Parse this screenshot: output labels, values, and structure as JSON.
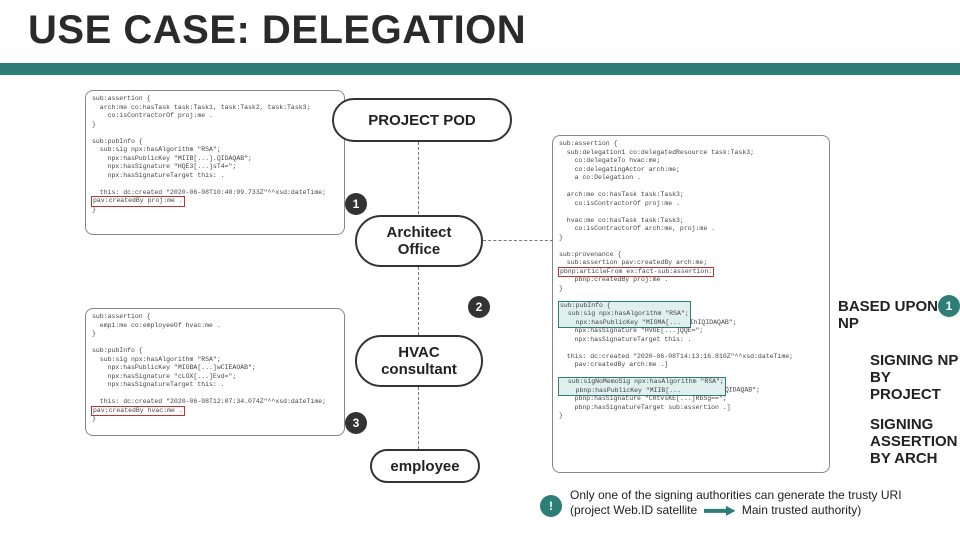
{
  "title": "USE CASE:   DELEGATION",
  "pills": {
    "project_pod": "PROJECT POD",
    "architect_office": "Architect\nOffice",
    "hvac_consultant": "HVAC\nconsultant",
    "employee": "employee"
  },
  "badges": {
    "n1": "1",
    "n2": "2",
    "n3": "3",
    "np1": "1",
    "excl": "!"
  },
  "labels": {
    "based_upon_np": "BASED UPON NP",
    "signing_project": "SIGNING NP\nBY PROJECT",
    "signing_arch": "SIGNING\nASSERTION\nBY ARCH"
  },
  "footer": {
    "line1": "Only one of the signing authorities can generate the trusty URI",
    "line2a": "(project Web.ID satellite",
    "line2b": "Main trusted authority)"
  },
  "code": {
    "box_tl": "sub:assertion {\n  arch:me co:hasTask task:Task1, task:Task2, task:Task3;\n    co:isContractorOf proj:me .\n}\n\nsub:pubInfo {\n  sub:sig npx:hasAlgorithm \"RSA\";\n    npx:hasPublicKey \"MIIB[...].QIDAQAB\";\n    npx:hasSignature \"HQE3[...]sT4=\";\n    npx:hasSignatureTarget this: .\n\n  this: dc:created \"2020-06-08T10:40:09.733Z\"^^xsd:dateTime;\nHL_RED[pav:createdBy proj:me .]\n}",
    "box_bl": "sub:assertion {\n  emp1:me co:employeeOf hvac:me .\n}\n\nsub:pubInfo {\n  sub:sig npx:hasAlgorithm \"RSA\";\n    npx:hasPublicKey \"MIGBA[...]wCIEAOAB\";\n    npx:hasSignature \"cLOX[...]Evd=\";\n    npx:hasSignatureTarget this: .\n\n  this: dc:created \"2020-06-08T12:07:34.074Z\"^^xsd:dateTime;\nHL_RED[pav:createdBy hvac:me .]\n}",
    "box_tr": "sub:assertion {\n  sub:delegation1 co:delegatedResource task:Task3;\n    co:delegateTo hvac:me;\n    co:delegatingActor arch:me;\n    a co:Delegation .\n\n  arch:me co:hasTask task:Task3;\n    co:isContractorOf proj:me .\n\n  hvac:me co:hasTask task:Task3;\n    co:isContractorOf arch:me, proj:me .\n}\n\nsub:provenance {\n  sub:assertion pav:createdBy arch:me;\nHL_RED[pbnp:articleFrom ex:fact-sub:assertion:]\n    pbnp:createdBy proj:me .\n}\n\nHL_TEAL[sub:pubInfo {\n  sub:sig npx:hasAlgorithm \"RSA\";\n    npx:hasPublicKey \"MIGMA[...]IhIQIDAQAB\";\n    npx:hasSignature \"HVGE[...]QQE=\";\n    npx:hasSignatureTarget this: .\n\n  this: dc:created \"2020-06-08T14:13:16.810Z\"^^xsd:dateTime;\n    pav:createdBy arch:me .]\n\nHL_TEAL[  sub:sigNoMemoSig npx:hasAlgorithm \"RSA\";\n    pbnp:hasPublicKey \"MIIB[...]QIDAQAB\";\n    pbnp:hasSignature \"CRtvsKE[...]RbSg==\";\n    pbnp:hasSignatureTarget sub:assertion .]\n}"
  },
  "chart_data": {
    "type": "diagram",
    "nodes": [
      {
        "id": "codebox_tl",
        "kind": "publication-code",
        "author": "proj:me"
      },
      {
        "id": "codebox_bl",
        "kind": "publication-code",
        "author": "hvac:me"
      },
      {
        "id": "codebox_tr",
        "kind": "publication-code",
        "author": "arch:me",
        "signed_by": [
          "project",
          "arch"
        ]
      },
      {
        "id": "project_pod",
        "kind": "pod",
        "label": "PROJECT POD"
      },
      {
        "id": "architect_office",
        "kind": "actor",
        "label": "Architect Office"
      },
      {
        "id": "hvac_consultant",
        "kind": "actor",
        "label": "HVAC consultant"
      },
      {
        "id": "employee",
        "kind": "actor",
        "label": "employee"
      }
    ],
    "edges": [
      {
        "from": "codebox_tl",
        "to": "project_pod",
        "style": "frame"
      },
      {
        "from": "project_pod",
        "to": "architect_office",
        "style": "dashed",
        "label": "1"
      },
      {
        "from": "architect_office",
        "to": "hvac_consultant",
        "style": "dashed",
        "label": "2"
      },
      {
        "from": "hvac_consultant",
        "to": "employee",
        "style": "dashed",
        "label": "3"
      },
      {
        "from": "codebox_bl",
        "to": "hvac_consultant",
        "style": "frame"
      },
      {
        "from": "architect_office",
        "to": "codebox_tr",
        "style": "frame"
      },
      {
        "from": "codebox_tr",
        "to": "codebox_tl",
        "style": "note",
        "label": "BASED UPON NP 1"
      }
    ]
  }
}
